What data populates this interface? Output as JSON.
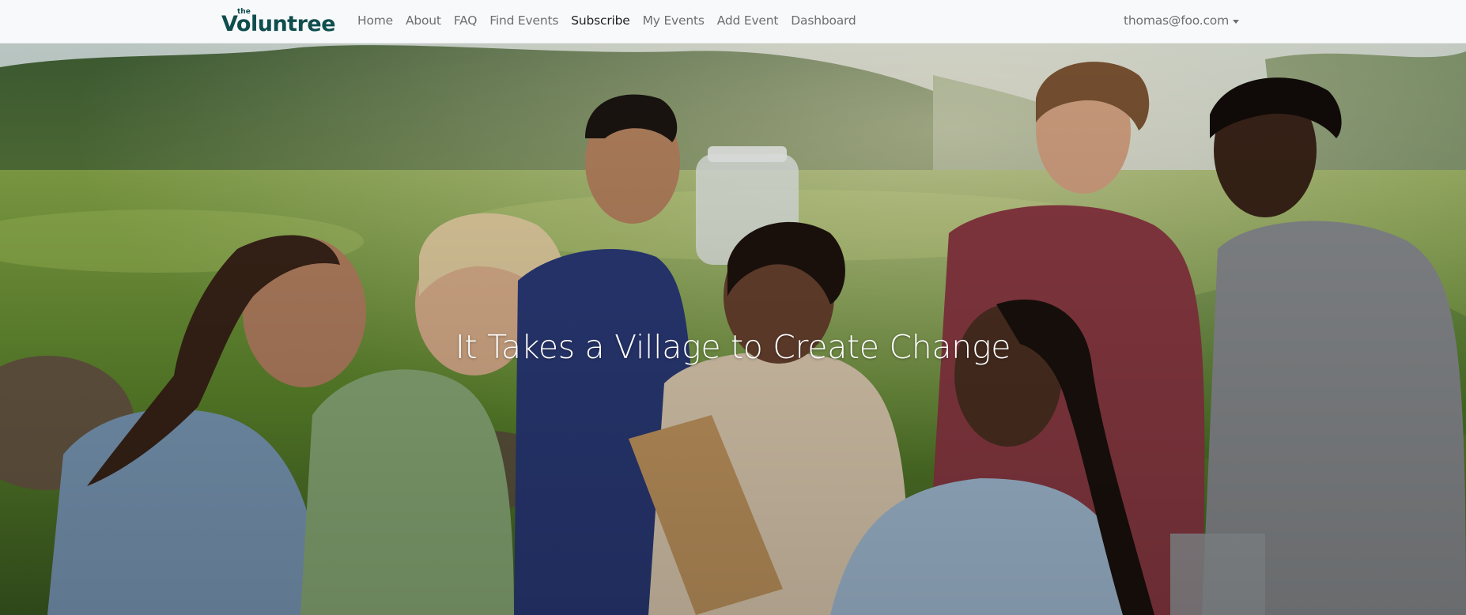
{
  "brand": {
    "prefix": "the",
    "name": "Voluntree",
    "color": "#0f4d4e"
  },
  "nav": {
    "items": [
      {
        "label": "Home"
      },
      {
        "label": "About"
      },
      {
        "label": "FAQ"
      },
      {
        "label": "Find Events"
      },
      {
        "label": "Subscribe"
      },
      {
        "label": "My Events"
      },
      {
        "label": "Add Event"
      },
      {
        "label": "Dashboard"
      }
    ],
    "active": "Subscribe"
  },
  "user_menu": {
    "email": "thomas@foo.com",
    "icon": "caret-down-icon"
  },
  "hero": {
    "title": "It Takes a Village to Create Change",
    "image": "volunteers-outdoors-photo"
  }
}
